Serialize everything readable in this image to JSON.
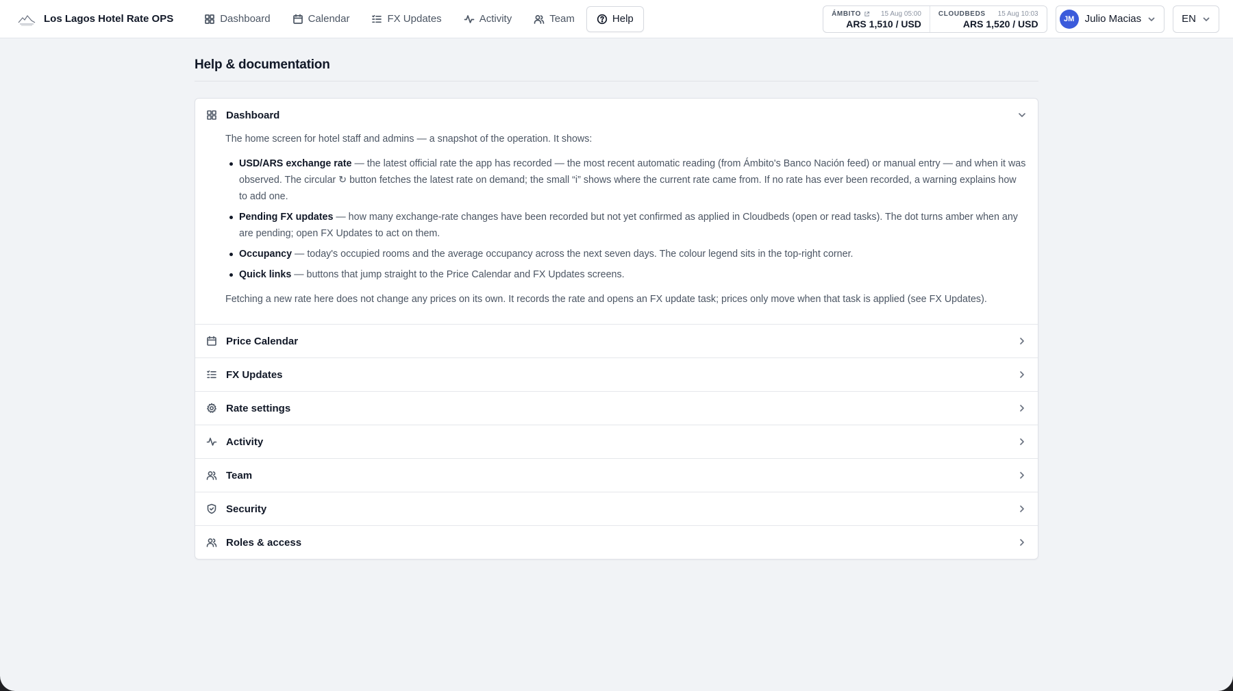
{
  "app": {
    "title": "Los Lagos Hotel Rate OPS"
  },
  "nav": {
    "items": [
      {
        "label": "Dashboard",
        "icon": "grid-icon"
      },
      {
        "label": "Calendar",
        "icon": "calendar-icon"
      },
      {
        "label": "FX Updates",
        "icon": "list-check-icon"
      },
      {
        "label": "Activity",
        "icon": "activity-icon"
      },
      {
        "label": "Team",
        "icon": "users-icon"
      },
      {
        "label": "Help",
        "icon": "help-circle-icon",
        "active": true
      }
    ]
  },
  "rates": {
    "ambito": {
      "label": "ÁMBITO",
      "time": "15 Aug 05:00",
      "value": "ARS 1,510 / USD"
    },
    "cloudbeds": {
      "label": "CLOUDBEDS",
      "time": "15 Aug 10:03",
      "value": "ARS 1,520 / USD"
    }
  },
  "user": {
    "initials": "JM",
    "name": "Julio Macias",
    "avatar_color": "#3b5bdb"
  },
  "lang": {
    "label": "EN"
  },
  "page": {
    "title": "Help & documentation"
  },
  "sections": {
    "dashboard": {
      "title": "Dashboard",
      "intro": "The home screen for hotel staff and admins — a snapshot of the operation. It shows:",
      "bullets": [
        {
          "term": "USD/ARS exchange rate",
          "text": " — the latest official rate the app has recorded — the most recent automatic reading (from Ámbito's Banco Nación feed) or manual entry — and when it was observed. The circular ↻ button fetches the latest rate on demand; the small “i” shows where the current rate came from. If no rate has ever been recorded, a warning explains how to add one."
        },
        {
          "term": "Pending FX updates",
          "text": " — how many exchange-rate changes have been recorded but not yet confirmed as applied in Cloudbeds (open or read tasks). The dot turns amber when any are pending; open FX Updates to act on them."
        },
        {
          "term": "Occupancy",
          "text": " — today's occupied rooms and the average occupancy across the next seven days. The colour legend sits in the top-right corner."
        },
        {
          "term": "Quick links",
          "text": " — buttons that jump straight to the Price Calendar and FX Updates screens."
        }
      ],
      "outro": "Fetching a new rate here does not change any prices on its own. It records the rate and opens an FX update task; prices only move when that task is applied (see FX Updates)."
    },
    "price_calendar": {
      "title": "Price Calendar"
    },
    "fx_updates": {
      "title": "FX Updates"
    },
    "rate_settings": {
      "title": "Rate settings"
    },
    "activity": {
      "title": "Activity"
    },
    "team": {
      "title": "Team"
    },
    "security": {
      "title": "Security"
    },
    "roles": {
      "title": "Roles & access"
    }
  }
}
